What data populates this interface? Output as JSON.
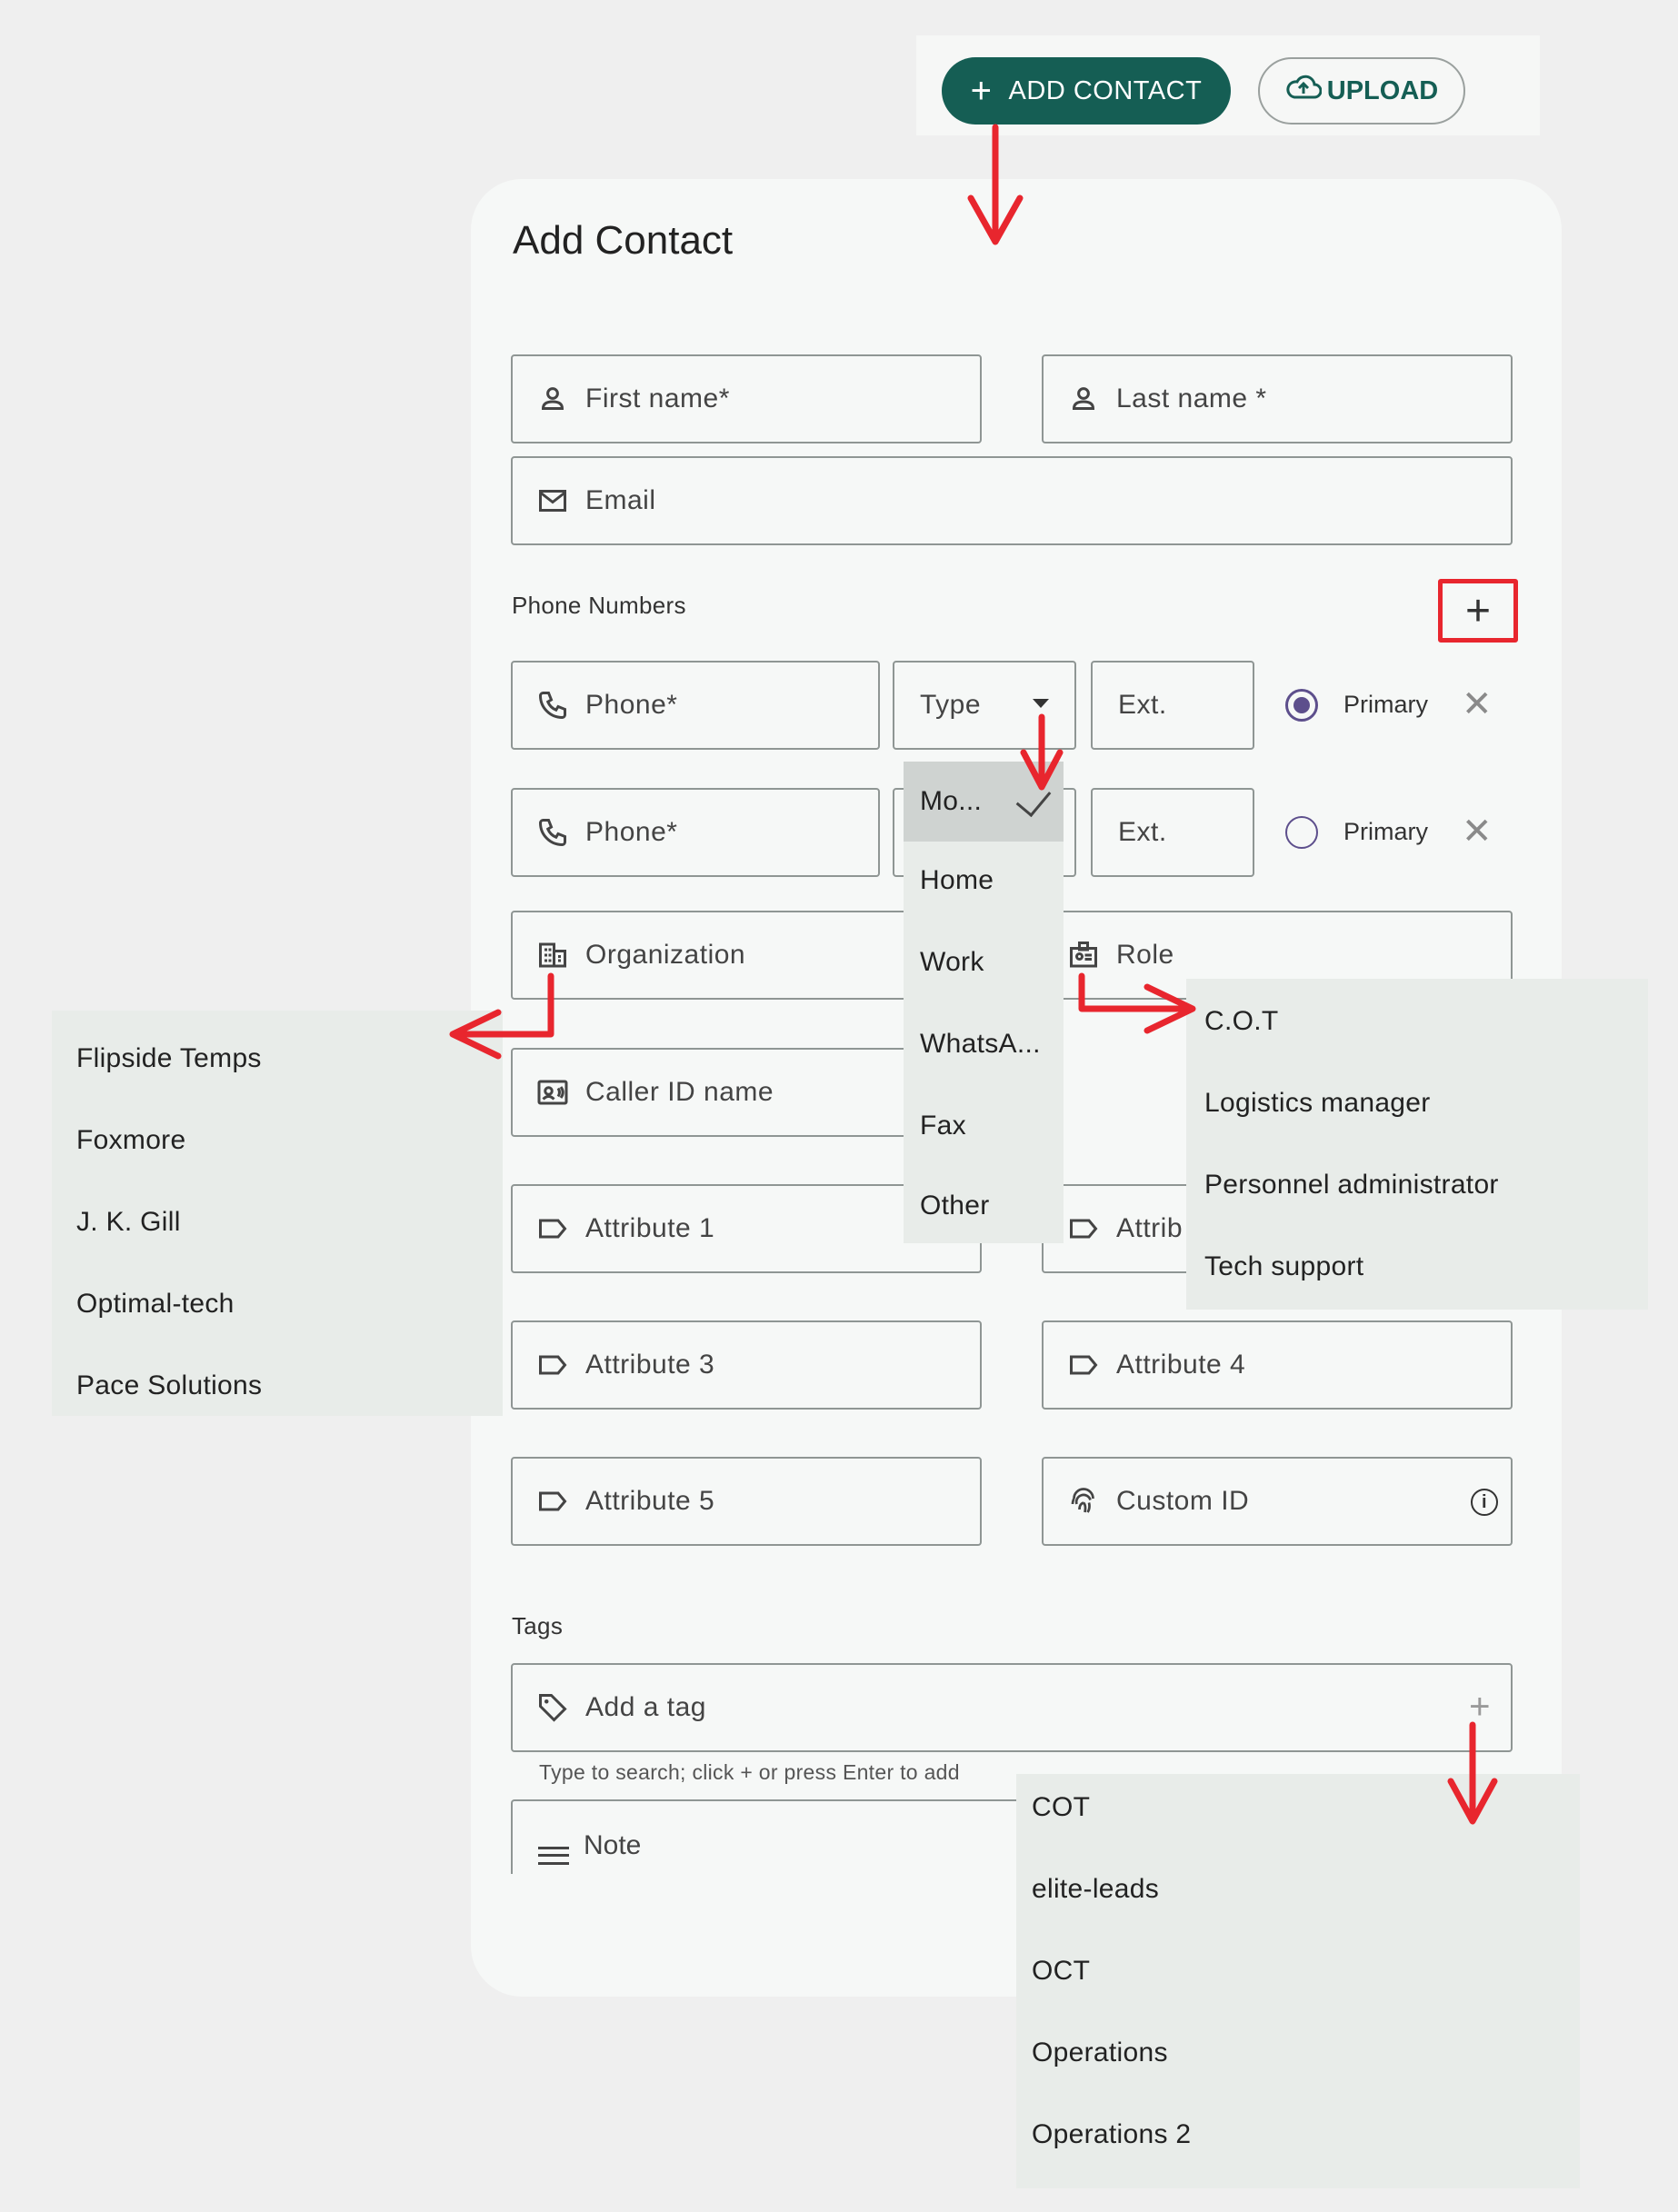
{
  "toolbar": {
    "add_contact_label": "ADD CONTACT",
    "upload_label": "UPLOAD"
  },
  "dialog": {
    "title": "Add Contact",
    "first_name_placeholder": "First name*",
    "last_name_placeholder": "Last name *",
    "email_placeholder": "Email",
    "phone_section_label": "Phone Numbers",
    "add_phone_glyph": "+",
    "phones": [
      {
        "phone_placeholder": "Phone*",
        "type_placeholder": "Type",
        "ext_placeholder": "Ext.",
        "primary_label": "Primary",
        "primary_selected": true
      },
      {
        "phone_placeholder": "Phone*",
        "ext_placeholder": "Ext.",
        "primary_label": "Primary",
        "primary_selected": false
      }
    ],
    "organization_placeholder": "Organization",
    "role_placeholder": "Role",
    "caller_id_placeholder": "Caller ID name",
    "attribute1_placeholder": "Attribute 1",
    "attribute2_placeholder": "Attrib",
    "attribute3_placeholder": "Attribute 3",
    "attribute4_placeholder": "Attribute 4",
    "attribute5_placeholder": "Attribute 5",
    "custom_id_placeholder": "Custom ID",
    "tags_section_label": "Tags",
    "tag_placeholder": "Add a tag",
    "tag_helper": "Type to search; click + or press Enter to add",
    "note_placeholder": "Note"
  },
  "type_menu": {
    "items": [
      "Mo...",
      "Home",
      "Work",
      "WhatsA...",
      "Fax",
      "Other"
    ],
    "selected_index": 0
  },
  "organization_menu": {
    "items": [
      "Flipside Temps",
      "Foxmore",
      "J. K. Gill",
      "Optimal-tech",
      "Pace Solutions"
    ]
  },
  "role_menu": {
    "items": [
      "C.O.T",
      "Logistics manager",
      "Personnel administrator",
      "Tech support"
    ]
  },
  "tag_menu": {
    "items": [
      "COT",
      "elite-leads",
      "OCT",
      "Operations",
      "Operations 2"
    ]
  },
  "colors": {
    "primary_button": "#155e54",
    "radio": "#5d4f8c",
    "annotation_red": "#e8262e",
    "menu_bg": "#e8ece9"
  }
}
